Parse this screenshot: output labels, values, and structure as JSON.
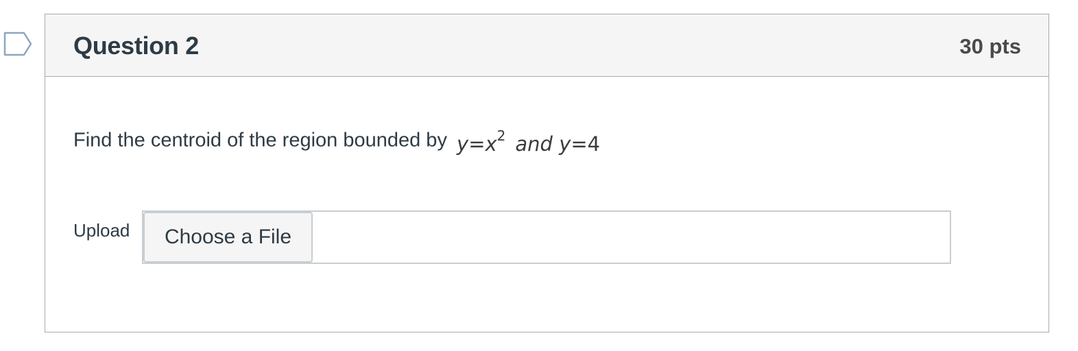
{
  "question": {
    "title": "Question 2",
    "points": "30 pts",
    "prompt": "Find the centroid of the region bounded by",
    "math": {
      "y1": "y",
      "eq1": "=",
      "x": "x",
      "exp": "2",
      "and": "and",
      "y2": "y",
      "eq2": "=",
      "four": "4"
    },
    "upload": {
      "label": "Upload",
      "button_label": "Choose a File"
    }
  },
  "colors": {
    "header_bg": "#f5f5f5",
    "border": "#aaaaaa",
    "text": "#2d3b45",
    "flag_stroke": "#8ea6c0"
  },
  "icons": {
    "flag": "bookmark-flag-icon"
  }
}
